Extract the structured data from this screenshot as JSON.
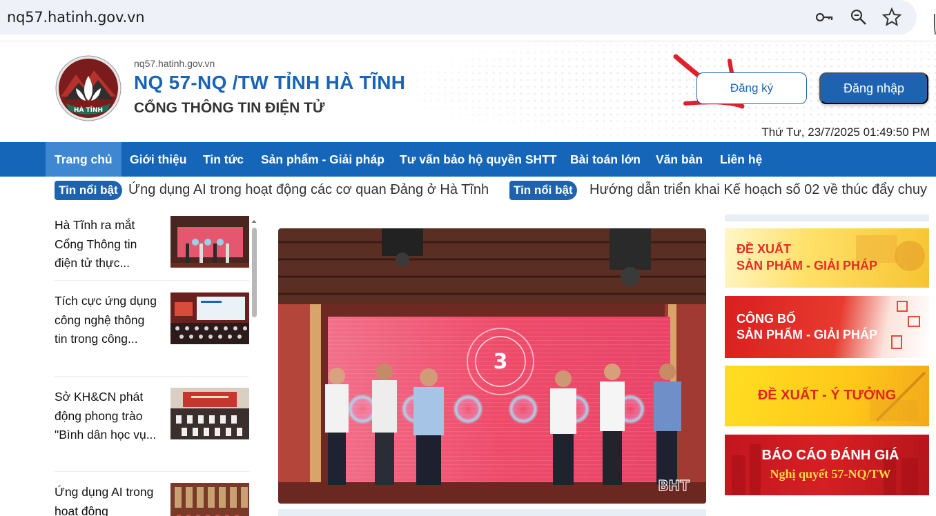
{
  "browser": {
    "url": "nq57.hatinh.gov.vn",
    "icons": [
      "key-icon",
      "zoom-icon",
      "star-icon"
    ]
  },
  "header": {
    "domain": "nq57.hatinh.gov.vn",
    "title": "NQ 57-NQ /TW TỈNH HÀ TĨNH",
    "subtitle": "CỔNG THÔNG TIN ĐIỆN TỬ",
    "logo_text": "HÀ TĨNH",
    "register_label": "Đăng ký",
    "login_label": "Đăng nhập",
    "datetime": "Thứ Tư, 23/7/2025 01:49:50 PM"
  },
  "nav": {
    "items": [
      "Trang chủ",
      "Giới thiệu",
      "Tin tức",
      "Sản phẩm - Giải pháp",
      "Tư vấn bảo hộ quyền SHTT",
      "Bài toán lớn",
      "Văn bản",
      "Liên hệ"
    ],
    "active_index": 0
  },
  "ticker": {
    "items": [
      {
        "badge": "Tin nổi bật",
        "text": "Ứng dụng AI trong hoạt động các cơ quan Đảng ở Hà Tĩnh"
      },
      {
        "badge": "Tin nổi bật",
        "text": "Hướng dẫn triển khai Kế hoạch số 02 về thúc đẩy chuy"
      }
    ]
  },
  "news": {
    "items": [
      {
        "title": "Hà Tĩnh ra mắt Cổng Thông tin điện tử thực..."
      },
      {
        "title": "Tích cực ứng dụng công nghệ thông tin trong công..."
      },
      {
        "title": "Sở KH&CN phát động phong trào \"Bình dân học vụ..."
      },
      {
        "title": "Ứng dụng AI trong hoạt động"
      }
    ]
  },
  "featured": {
    "countdown": "3",
    "watermark": "BHT"
  },
  "banners": [
    {
      "line1": "ĐỀ XUẤT",
      "line2": "SẢN PHẨM - GIẢI PHÁP"
    },
    {
      "line1": "CÔNG BỐ",
      "line2": "SẢN PHẨM - GIẢI PHÁP"
    },
    {
      "line1": "ĐỀ XUẤT - Ý TƯỞNG"
    },
    {
      "line1": "BÁO CÁO ĐÁNH GIÁ",
      "line2": "Nghị quyết 57-NQ/TW"
    }
  ],
  "colors": {
    "brand_blue": "#1565b8",
    "nav_active": "#3f87d0",
    "title_blue": "#1a64b5"
  }
}
